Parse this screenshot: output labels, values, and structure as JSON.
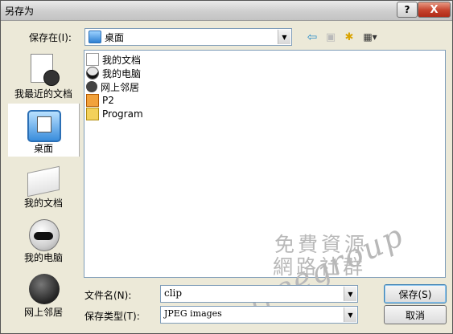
{
  "window": {
    "title": "另存为",
    "help_glyph": "?",
    "close_glyph": "X"
  },
  "location": {
    "label": "保存在(I):",
    "value": "桌面"
  },
  "toolbar": {
    "back_glyph": "⇦",
    "up_glyph": "▣",
    "newfolder_glyph": "✱",
    "view_glyph": "▦▾"
  },
  "places": [
    {
      "label": "我最近的文档"
    },
    {
      "label": "桌面"
    },
    {
      "label": "我的文档"
    },
    {
      "label": "我的电脑"
    },
    {
      "label": "网上邻居"
    }
  ],
  "files": [
    {
      "name": "我的文档"
    },
    {
      "name": "我的电脑"
    },
    {
      "name": "网上邻居"
    },
    {
      "name": "P2"
    },
    {
      "name": "Program"
    }
  ],
  "filename": {
    "label": "文件名(N):",
    "value": "clip"
  },
  "filetype": {
    "label": "保存类型(T):",
    "value": "JPEG images"
  },
  "buttons": {
    "save": "保存(S)",
    "cancel": "取消"
  },
  "watermark": {
    "line1": "免費資源",
    "line2": "網路社群",
    "line3": "freegroup"
  },
  "colors": {
    "selection": "#ffffff",
    "accent": "#7f9db9",
    "close": "#c5422c"
  }
}
